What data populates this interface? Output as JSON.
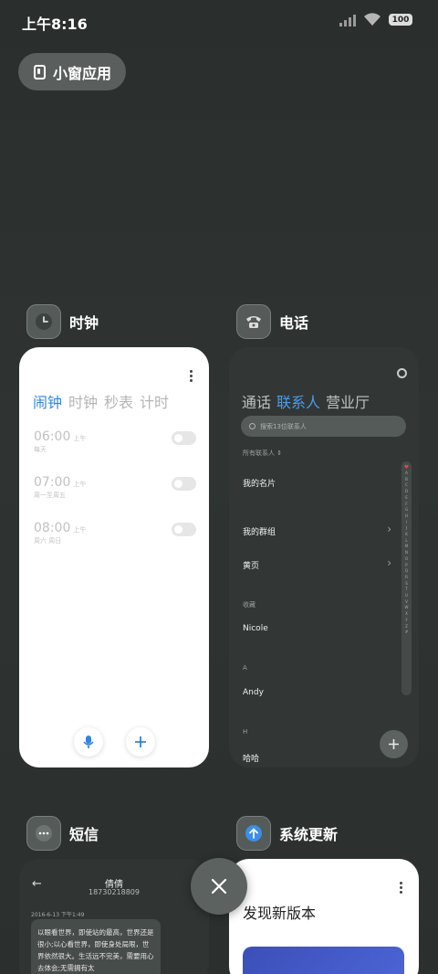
{
  "status_bar": {
    "time": "上午8:16",
    "battery": "100"
  },
  "small_window": {
    "label": "小窗应用"
  },
  "apps": {
    "clock": {
      "name": "时钟",
      "tabs": [
        "闹钟",
        "时钟",
        "秒表",
        "计时"
      ],
      "alarms": [
        {
          "time": "06:00",
          "ampm": "上午",
          "days": "每天"
        },
        {
          "time": "07:00",
          "ampm": "上午",
          "days": "周一至周五"
        },
        {
          "time": "08:00",
          "ampm": "上午",
          "days": "周六 周日"
        }
      ]
    },
    "phone": {
      "name": "电话",
      "tabs": [
        "通话",
        "联系人",
        "营业厅"
      ],
      "search_placeholder": "搜索13位联系人",
      "all_contacts": "所有联系人",
      "my_card": "我的名片",
      "my_groups": "我的群组",
      "yellow_pages": "黄页",
      "favorites_label": "收藏",
      "contact_nicole": "Nicole",
      "section_a": "A",
      "contact_andy": "Andy",
      "section_h": "H",
      "contact_haha": "哈哈",
      "alphabet": [
        "A",
        "B",
        "C",
        "D",
        "E",
        "F",
        "G",
        "H",
        "I",
        "J",
        "K",
        "L",
        "M",
        "N",
        "O",
        "P",
        "Q",
        "R",
        "S",
        "T",
        "U",
        "V",
        "W",
        "X",
        "Y",
        "Z",
        "#"
      ]
    },
    "sms": {
      "name": "短信",
      "contact_name": "倩倩",
      "contact_number": "18730218809",
      "date": "2016-6-13 下午1:49",
      "message": "以眼看世界，即使站的最高，世界还是很小;以心看世界，即使身处局限，世界依然很大。生活远不完美，需要用心去体会;无需拥有太"
    },
    "update": {
      "name": "系统更新",
      "title": "发现新版本"
    }
  },
  "colors": {
    "accent": "#3482e0",
    "background": "#2d3230"
  }
}
